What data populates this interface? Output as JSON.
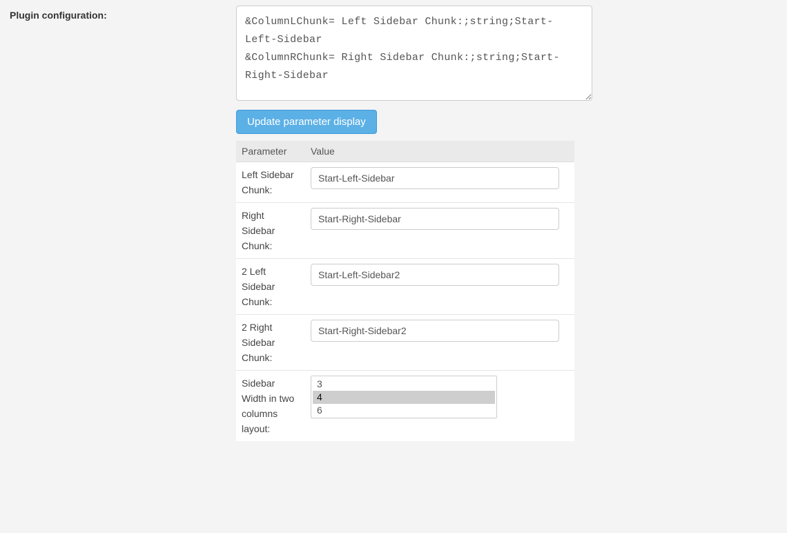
{
  "label": "Plugin configuration:",
  "config_text": "&ColumnLChunk= Left Sidebar Chunk:;string;Start-Left-Sidebar\n&ColumnRChunk= Right Sidebar Chunk:;string;Start-Right-Sidebar",
  "update_button": "Update parameter display",
  "headers": {
    "param": "Parameter",
    "value": "Value"
  },
  "rows": [
    {
      "param": "Left Sidebar Chunk:",
      "value": "Start-Left-Sidebar"
    },
    {
      "param": "Right Sidebar Chunk:",
      "value": "Start-Right-Sidebar"
    },
    {
      "param": "2 Left Sidebar Chunk:",
      "value": "Start-Left-Sidebar2"
    },
    {
      "param": "2 Right Sidebar Chunk:",
      "value": "Start-Right-Sidebar2"
    }
  ],
  "width_row": {
    "param": "Sidebar Width in two columns layout:",
    "options": [
      "3",
      "4",
      "6"
    ],
    "selected": "4"
  }
}
